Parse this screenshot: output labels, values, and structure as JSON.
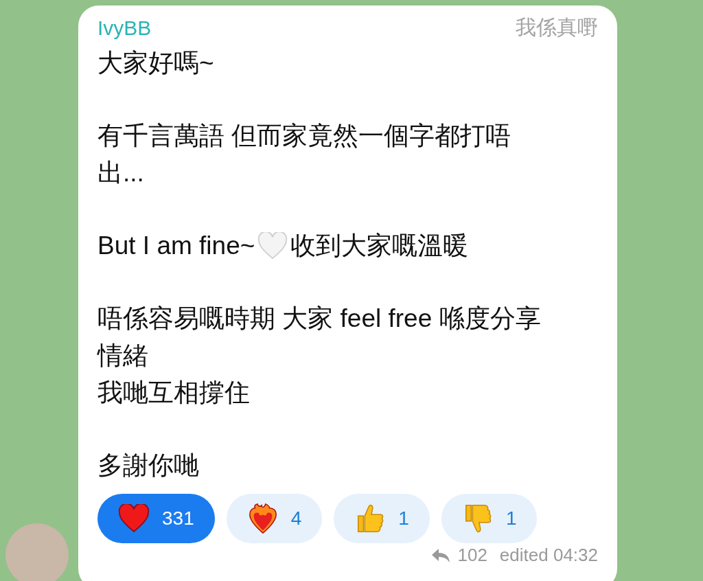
{
  "message": {
    "sender": "IvyBB",
    "badge": "我係真嘢",
    "paragraphs": [
      {
        "lines": [
          [
            {
              "kind": "text",
              "text": "大家好嗎~"
            }
          ]
        ]
      },
      {
        "lines": [
          [
            {
              "kind": "text",
              "text": "有千言萬語 但而家竟然一個字都打唔"
            }
          ],
          [
            {
              "kind": "text",
              "text": "出..."
            }
          ]
        ]
      },
      {
        "lines": [
          [
            {
              "kind": "text",
              "text": "But I am fine~"
            },
            {
              "kind": "white_heart"
            },
            {
              "kind": "text",
              "text": "收到大家嘅溫暖"
            }
          ]
        ]
      },
      {
        "lines": [
          [
            {
              "kind": "text",
              "text": "唔係容易嘅時期 大家 feel free 喺度分享"
            }
          ],
          [
            {
              "kind": "text",
              "text": "情緒"
            }
          ],
          [
            {
              "kind": "text",
              "text": "我哋互相撐住"
            }
          ]
        ]
      },
      {
        "lines": [
          [
            {
              "kind": "text",
              "text": "多謝你哋"
            }
          ]
        ]
      }
    ],
    "reactions": [
      {
        "kind": "heart",
        "count": "331",
        "selected": true
      },
      {
        "kind": "fire_heart",
        "count": "4",
        "selected": false
      },
      {
        "kind": "thumbs_up",
        "count": "1",
        "selected": false
      },
      {
        "kind": "thumbs_down",
        "count": "1",
        "selected": false
      }
    ],
    "replies": "102",
    "edited": "edited 04:32"
  }
}
